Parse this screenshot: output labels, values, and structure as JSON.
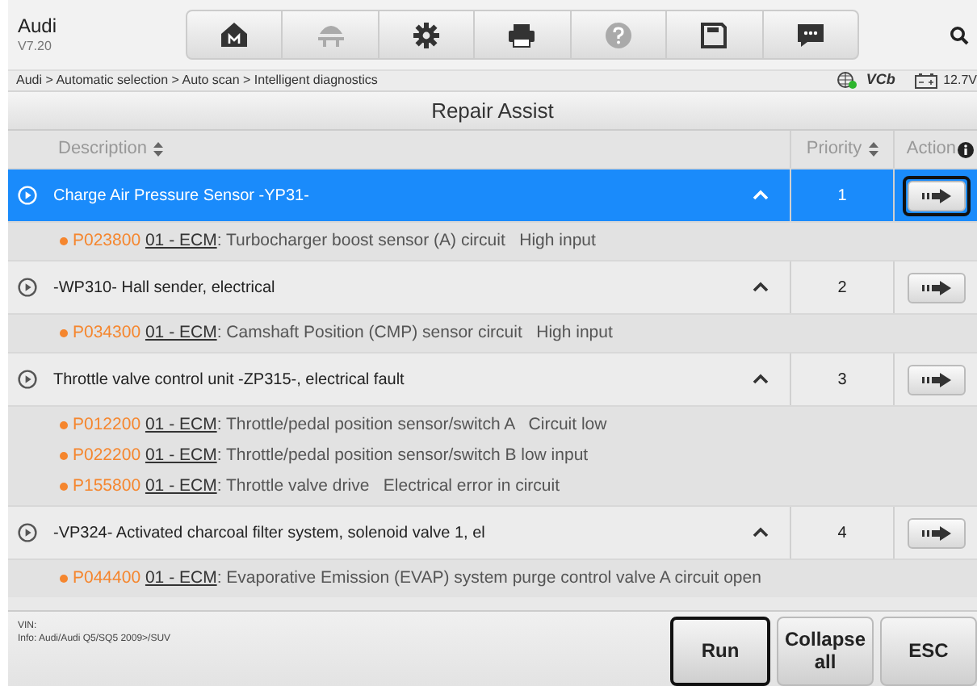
{
  "app": {
    "title": "Audi",
    "version": "V7.20"
  },
  "toolbar": [
    {
      "kind": "home",
      "disabled": false
    },
    {
      "kind": "lift",
      "disabled": true
    },
    {
      "kind": "gear",
      "disabled": false
    },
    {
      "kind": "printer",
      "disabled": false
    },
    {
      "kind": "help",
      "disabled": true
    },
    {
      "kind": "save",
      "disabled": false
    },
    {
      "kind": "chat",
      "disabled": false
    }
  ],
  "breadcrumb": "Audi > Automatic selection > Auto scan > Intelligent diagnostics",
  "status": {
    "vci_label": "VCb",
    "voltage": "12.7V"
  },
  "title": "Repair Assist",
  "columns": [
    "Description",
    "Priority",
    "Action"
  ],
  "rows": [
    {
      "description": "Charge Air Pressure Sensor -YP31-",
      "priority": "1",
      "selected": true,
      "expanded": true,
      "action_focused": true,
      "faults": [
        {
          "code": "P023800",
          "module": "01 - ECM",
          "text": ": Turbocharger boost sensor (A) circuit   High input"
        }
      ]
    },
    {
      "description": "-WP310- Hall sender, electrical",
      "priority": "2",
      "selected": false,
      "expanded": true,
      "action_focused": false,
      "faults": [
        {
          "code": "P034300",
          "module": "01 - ECM",
          "text": ": Camshaft Position (CMP) sensor circuit   High input"
        }
      ]
    },
    {
      "description": "Throttle valve control unit -ZP315-, electrical fault",
      "priority": "3",
      "selected": false,
      "expanded": true,
      "action_focused": false,
      "faults": [
        {
          "code": "P012200",
          "module": "01 - ECM",
          "text": ": Throttle/pedal position sensor/switch A   Circuit low"
        },
        {
          "code": "P022200",
          "module": "01 - ECM",
          "text": ": Throttle/pedal position sensor/switch B low input"
        },
        {
          "code": "P155800",
          "module": "01 - ECM",
          "text": ": Throttle valve drive   Electrical error in circuit"
        }
      ]
    },
    {
      "description": "-VP324- Activated charcoal filter system, solenoid valve 1, el",
      "priority": "4",
      "selected": false,
      "expanded": true,
      "action_focused": false,
      "faults": [
        {
          "code": "P044400",
          "module": "01 - ECM",
          "text": ": Evaporative Emission (EVAP) system purge control valve A circuit open"
        }
      ]
    }
  ],
  "footer": {
    "vin": "VIN:",
    "info": "Info: Audi/Audi Q5/SQ5 2009>/SUV"
  },
  "buttons": [
    {
      "label": "Run",
      "focused": true
    },
    {
      "label": "Collapse all",
      "focused": false
    },
    {
      "label": "ESC",
      "focused": false
    }
  ]
}
